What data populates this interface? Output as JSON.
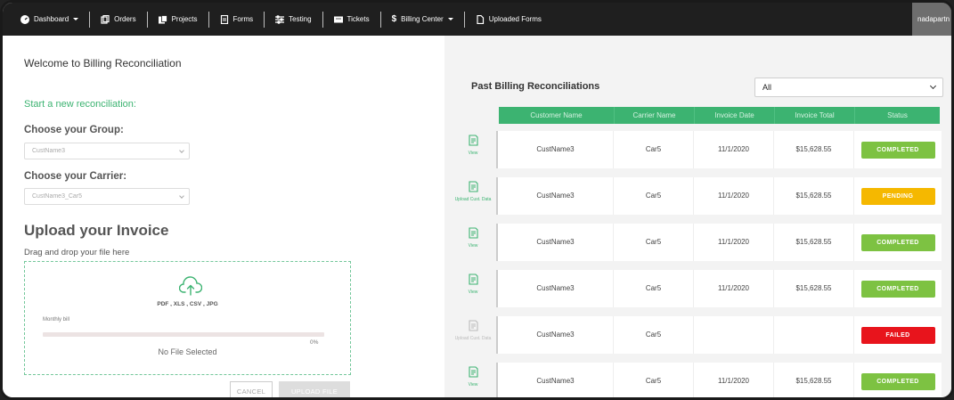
{
  "nav": {
    "items": [
      {
        "label": "Dashboard",
        "caret": true,
        "icon": "dashboard-icon"
      },
      {
        "label": "Orders",
        "caret": false,
        "icon": "orders-icon"
      },
      {
        "label": "Projects",
        "caret": false,
        "icon": "projects-icon"
      },
      {
        "label": "Forms",
        "caret": false,
        "icon": "forms-icon"
      },
      {
        "label": "Testing",
        "caret": false,
        "icon": "testing-icon"
      },
      {
        "label": "Tickets",
        "caret": false,
        "icon": "tickets-icon"
      },
      {
        "label": "Billing Center",
        "caret": true,
        "icon": "dollar-icon"
      },
      {
        "label": "Uploaded Forms",
        "caret": false,
        "icon": "uploaded-forms-icon"
      }
    ],
    "user": "nadapartn"
  },
  "left": {
    "welcome": "Welcome to Billing Reconciliation",
    "start_new": "Start a new reconciliation:",
    "group_label": "Choose your Group:",
    "group_value": "CustName3",
    "carrier_label": "Choose your Carrier:",
    "carrier_value": "CustName3_Car5",
    "upload_title": "Upload your Invoice",
    "drag_text": "Drag and drop your file here",
    "formats": "PDF , XLS , CSV , JPG",
    "monthly_label": "Monthly bill",
    "progress_percent": "0%",
    "progress_value": 0,
    "no_file": "No File Selected",
    "cancel_label": "CANCEL",
    "upload_label": "UPLOAD FILE"
  },
  "right": {
    "title": "Past Billing Reconciliations",
    "filter_value": "All",
    "headers": [
      "Customer Name",
      "Carrier Name",
      "Invoice Date",
      "Invoice Total",
      "Status"
    ],
    "rows": [
      {
        "action": "View",
        "action_dim": false,
        "customer": "CustName3",
        "carrier": "Car5",
        "date": "11/1/2020",
        "total": "$15,628.55",
        "status": "COMPLETED",
        "status_color": "#7dc242"
      },
      {
        "action": "Upload Cust. Data",
        "action_dim": false,
        "customer": "CustName3",
        "carrier": "Car5",
        "date": "11/1/2020",
        "total": "$15,628.55",
        "status": "PENDING",
        "status_color": "#f5b800"
      },
      {
        "action": "View",
        "action_dim": false,
        "customer": "CustName3",
        "carrier": "Car5",
        "date": "11/1/2020",
        "total": "$15,628.55",
        "status": "COMPLETED",
        "status_color": "#7dc242"
      },
      {
        "action": "View",
        "action_dim": false,
        "customer": "CustName3",
        "carrier": "Car5",
        "date": "11/1/2020",
        "total": "$15,628.55",
        "status": "COMPLETED",
        "status_color": "#7dc242"
      },
      {
        "action": "Upload Cust. Data",
        "action_dim": true,
        "customer": "CustName3",
        "carrier": "Car5",
        "date": "",
        "total": "",
        "status": "FAILED",
        "status_color": "#e8141c"
      },
      {
        "action": "View",
        "action_dim": false,
        "customer": "CustName3",
        "carrier": "Car5",
        "date": "11/1/2020",
        "total": "$15,628.55",
        "status": "COMPLETED",
        "status_color": "#7dc242"
      }
    ]
  },
  "colors": {
    "accent": "#3cb371",
    "nav_bg": "#1f1f1f"
  }
}
